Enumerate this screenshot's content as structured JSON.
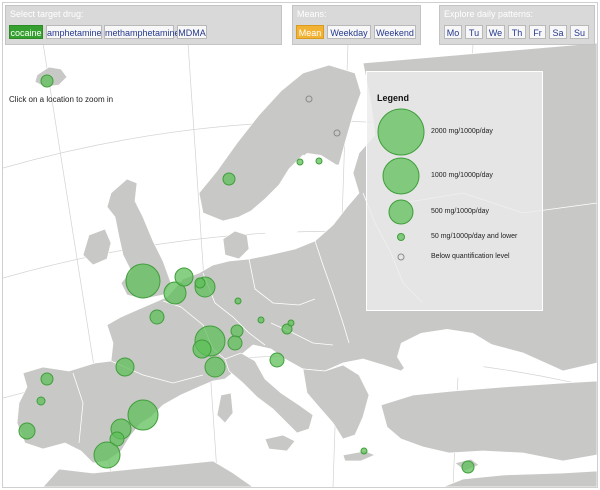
{
  "drug_panel": {
    "title": "Select target drug:",
    "options": [
      "cocaine",
      "amphetamine",
      "methamphetamine",
      "MDMA"
    ],
    "selected": "cocaine"
  },
  "means_panel": {
    "title": "Means:",
    "options": [
      "Mean",
      "Weekday",
      "Weekend"
    ],
    "selected": "Mean"
  },
  "daily_panel": {
    "title": "Explore daily patterns:",
    "days": [
      "Mo",
      "Tu",
      "We",
      "Th",
      "Fr",
      "Sa",
      "Su"
    ]
  },
  "hint": "Click on a location to zoom in",
  "legend": {
    "title": "Legend",
    "items": [
      {
        "label": "2000 mg/1000p/day",
        "value": 2000
      },
      {
        "label": "1000 mg/1000p/day",
        "value": 1000
      },
      {
        "label": "500 mg/1000p/day",
        "value": 500
      },
      {
        "label": "50 mg/1000p/day and lower",
        "value": 50
      },
      {
        "label": "Below quantification level",
        "value": 0
      }
    ]
  },
  "colors": {
    "marker_fill": "#5fbf5a",
    "marker_stroke": "#3f9e3a",
    "land": "#c8c8c6",
    "sea": "#ffffff",
    "selected_drug": "#35a02f",
    "selected_mean": "#f2b233",
    "button_text": "#24398f"
  }
}
